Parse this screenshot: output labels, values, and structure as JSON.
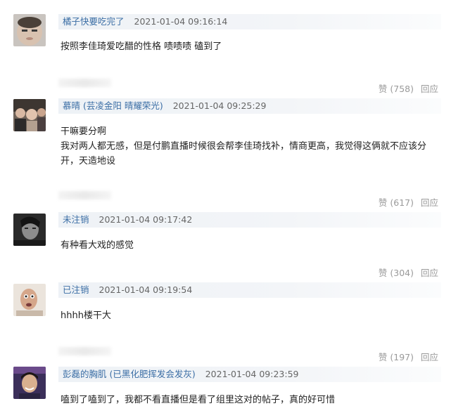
{
  "comments": [
    {
      "user": "橘子快要吃完了",
      "time": "2021-01-04 09:16:14",
      "lines": [
        "按照李佳琦爱吃醋的性格 啧啧啧 磕到了"
      ],
      "like": "赞 (758)",
      "reply": "回应",
      "avatar_icon": "avatar-round-face"
    },
    {
      "user": "慕晴 (芸凌金阳 晴耀荣光)",
      "time": "2021-01-04 09:25:29",
      "lines": [
        "干嘛要分啊",
        "我对两人都无感，但是付鹏直播时候很会帮李佳琦找补，情商更高，我觉得这俩就不应该分",
        "开，天造地设"
      ],
      "like": "赞 (617)",
      "reply": "回应",
      "avatar_icon": "avatar-crowd-photo"
    },
    {
      "user": "未注销",
      "time": "2021-01-04 09:17:42",
      "lines": [
        "有种看大戏的感觉"
      ],
      "like": "赞 (304)",
      "reply": "回应",
      "avatar_icon": "avatar-dark-portrait"
    },
    {
      "user": "已注销",
      "time": "2021-01-04 09:19:54",
      "lines": [
        "hhhh楼干大"
      ],
      "like": "赞 (197)",
      "reply": "回应",
      "avatar_icon": "avatar-hand-photo"
    },
    {
      "user": "彭磊的胸肌 (已黑化肥挥发会发灰)",
      "time": "2021-01-04 09:23:59",
      "lines": [
        "嗑到了嗑到了，我都不看直播但是看了组里这对的帖子，真的好可惜"
      ],
      "like": "",
      "reply": "",
      "avatar_icon": "avatar-smiling-person"
    }
  ]
}
